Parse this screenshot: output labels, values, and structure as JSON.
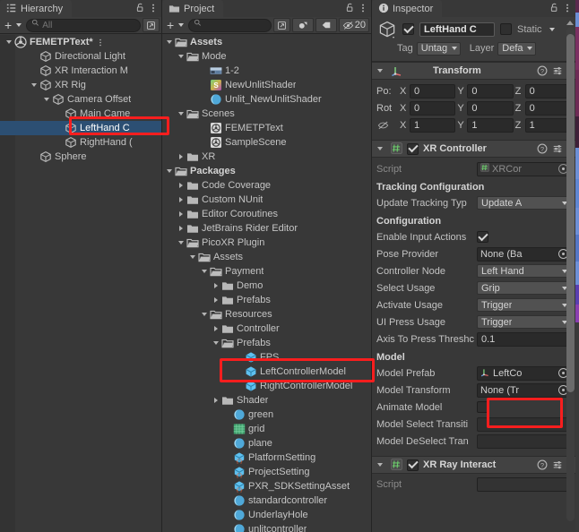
{
  "hierarchy": {
    "tab_label": "Hierarchy",
    "lock_icon": "lock-icon",
    "menu_icon": "kebab-menu-icon",
    "create_label": "+",
    "search_placeholder": "All",
    "search_value": "",
    "rows": [
      {
        "label": "FEMETPText*",
        "depth": 0,
        "arrow": "down",
        "icon": "scene-icon",
        "bold": true,
        "selected": false,
        "kebab": true
      },
      {
        "label": "Directional Light",
        "depth": 2,
        "arrow": "none",
        "icon": "gameobject-icon",
        "bold": false,
        "selected": false
      },
      {
        "label": "XR Interaction M",
        "depth": 2,
        "arrow": "none",
        "icon": "gameobject-icon",
        "bold": false,
        "selected": false
      },
      {
        "label": "XR Rig",
        "depth": 2,
        "arrow": "down",
        "icon": "gameobject-icon",
        "bold": false,
        "selected": false
      },
      {
        "label": "Camera Offset",
        "depth": 3,
        "arrow": "down",
        "icon": "gameobject-icon",
        "bold": false,
        "selected": false
      },
      {
        "label": "Main Came",
        "depth": 4,
        "arrow": "none",
        "icon": "gameobject-icon",
        "bold": false,
        "selected": false
      },
      {
        "label": "LeftHand C",
        "depth": 4,
        "arrow": "none",
        "icon": "gameobject-icon",
        "bold": false,
        "selected": true
      },
      {
        "label": "RightHand (",
        "depth": 4,
        "arrow": "none",
        "icon": "gameobject-icon",
        "bold": false,
        "selected": false
      },
      {
        "label": "Sphere",
        "depth": 2,
        "arrow": "none",
        "icon": "gameobject-icon",
        "bold": false,
        "selected": false
      }
    ]
  },
  "project": {
    "tab_label": "Project",
    "lock_icon": "lock-icon",
    "menu_icon": "kebab-menu-icon",
    "create_label": "+",
    "search_placeholder": "",
    "search_value": "",
    "filter_icons": [
      "asset-type-filter-icon",
      "label-filter-icon"
    ],
    "hidden_count_label": "20",
    "rows": [
      {
        "label": "Assets",
        "depth": 0,
        "arrow": "down",
        "icon": "folder-open-icon",
        "bold": true
      },
      {
        "label": "Mode",
        "depth": 1,
        "arrow": "down",
        "icon": "folder-open-icon",
        "bold": false
      },
      {
        "label": "1-2",
        "depth": 3,
        "arrow": "none",
        "icon": "image-icon",
        "bold": false
      },
      {
        "label": "NewUnlitShader",
        "depth": 3,
        "arrow": "none",
        "icon": "shader-icon",
        "bold": false
      },
      {
        "label": "Unlit_NewUnlitShader",
        "depth": 3,
        "arrow": "none",
        "icon": "material-icon",
        "bold": false
      },
      {
        "label": "Scenes",
        "depth": 1,
        "arrow": "down",
        "icon": "folder-open-icon",
        "bold": false
      },
      {
        "label": "FEMETPText",
        "depth": 3,
        "arrow": "none",
        "icon": "scene-asset-icon",
        "bold": false
      },
      {
        "label": "SampleScene",
        "depth": 3,
        "arrow": "none",
        "icon": "scene-asset-icon",
        "bold": false
      },
      {
        "label": "XR",
        "depth": 1,
        "arrow": "right",
        "icon": "folder-icon",
        "bold": false
      },
      {
        "label": "Packages",
        "depth": 0,
        "arrow": "down",
        "icon": "folder-open-icon",
        "bold": true
      },
      {
        "label": "Code Coverage",
        "depth": 1,
        "arrow": "right",
        "icon": "folder-icon",
        "bold": false
      },
      {
        "label": "Custom NUnit",
        "depth": 1,
        "arrow": "right",
        "icon": "folder-icon",
        "bold": false
      },
      {
        "label": "Editor Coroutines",
        "depth": 1,
        "arrow": "right",
        "icon": "folder-icon",
        "bold": false
      },
      {
        "label": "JetBrains Rider Editor",
        "depth": 1,
        "arrow": "right",
        "icon": "folder-icon",
        "bold": false
      },
      {
        "label": "PicoXR Plugin",
        "depth": 1,
        "arrow": "down",
        "icon": "folder-open-icon",
        "bold": false
      },
      {
        "label": "Assets",
        "depth": 2,
        "arrow": "down",
        "icon": "folder-open-icon",
        "bold": false
      },
      {
        "label": "Payment",
        "depth": 3,
        "arrow": "down",
        "icon": "folder-open-icon",
        "bold": false
      },
      {
        "label": "Demo",
        "depth": 4,
        "arrow": "right",
        "icon": "folder-icon",
        "bold": false
      },
      {
        "label": "Prefabs",
        "depth": 4,
        "arrow": "right",
        "icon": "folder-icon",
        "bold": false
      },
      {
        "label": "Resources",
        "depth": 3,
        "arrow": "down",
        "icon": "folder-open-icon",
        "bold": false
      },
      {
        "label": "Controller",
        "depth": 4,
        "arrow": "right",
        "icon": "folder-icon",
        "bold": false
      },
      {
        "label": "Prefabs",
        "depth": 4,
        "arrow": "down",
        "icon": "folder-open-icon",
        "bold": false
      },
      {
        "label": "FPS",
        "depth": 6,
        "arrow": "none",
        "icon": "prefab-icon",
        "bold": false
      },
      {
        "label": "LeftControllerModel",
        "depth": 6,
        "arrow": "none",
        "icon": "prefab-icon",
        "bold": false
      },
      {
        "label": "RightControllerModel",
        "depth": 6,
        "arrow": "none",
        "icon": "prefab-icon",
        "bold": false
      },
      {
        "label": "Shader",
        "depth": 4,
        "arrow": "right",
        "icon": "folder-icon",
        "bold": false
      },
      {
        "label": "green",
        "depth": 5,
        "arrow": "none",
        "icon": "material-icon",
        "bold": false
      },
      {
        "label": "grid",
        "depth": 5,
        "arrow": "none",
        "icon": "texture-icon",
        "bold": false
      },
      {
        "label": "plane",
        "depth": 5,
        "arrow": "none",
        "icon": "material-icon",
        "bold": false
      },
      {
        "label": "PlatformSetting",
        "depth": 5,
        "arrow": "none",
        "icon": "scriptable-object-icon",
        "bold": false
      },
      {
        "label": "ProjectSetting",
        "depth": 5,
        "arrow": "none",
        "icon": "scriptable-object-icon",
        "bold": false
      },
      {
        "label": "PXR_SDKSettingAsset",
        "depth": 5,
        "arrow": "none",
        "icon": "scriptable-object-icon",
        "bold": false
      },
      {
        "label": "standardcontroller",
        "depth": 5,
        "arrow": "none",
        "icon": "material-icon",
        "bold": false
      },
      {
        "label": "UnderlayHole",
        "depth": 5,
        "arrow": "none",
        "icon": "material-icon",
        "bold": false
      },
      {
        "label": "unlitcontroller",
        "depth": 5,
        "arrow": "none",
        "icon": "material-icon",
        "bold": false
      }
    ]
  },
  "inspector": {
    "tab_label": "Inspector",
    "tab_icon": "info-icon",
    "lock_icon": "lock-icon",
    "menu_icon": "kebab-menu-icon",
    "object_icon": "gameobject-icon",
    "enabled": true,
    "name_value": "LeftHand C",
    "static_label": "Static",
    "static_checked": false,
    "tag_label": "Tag",
    "tag_value": "Untag",
    "layer_label": "Layer",
    "layer_value": "Defa",
    "transform": {
      "title": "Transform",
      "icon": "transform-icon",
      "help_icon": "help-icon",
      "preset_icon": "preset-icon",
      "menu_icon": "kebab-menu-icon",
      "position_label": "Po:",
      "rotation_label": "Rot",
      "scale_label": "scale-lock-icon",
      "axes": [
        "X",
        "Y",
        "Z"
      ],
      "position": [
        "0",
        "0",
        "0"
      ],
      "rotation": [
        "0",
        "0",
        "0"
      ],
      "scale": [
        "1",
        "1",
        "1"
      ]
    },
    "xr_controller": {
      "title": "XR Controller",
      "icon": "script-icon",
      "enabled": true,
      "help_icon": "help-icon",
      "preset_icon": "preset-icon",
      "menu_icon": "kebab-menu-icon",
      "script_label": "Script",
      "script_value": "XRCor",
      "tracking_section": "Tracking Configuration",
      "update_tracking_label": "Update Tracking Typ",
      "update_tracking_value": "Update A",
      "configuration_section": "Configuration",
      "enable_input_actions_label": "Enable Input Actions",
      "enable_input_actions_checked": true,
      "pose_provider_label": "Pose Provider",
      "pose_provider_value": "None (Ba",
      "controller_node_label": "Controller Node",
      "controller_node_value": "Left Hand",
      "select_usage_label": "Select Usage",
      "select_usage_value": "Grip",
      "activate_usage_label": "Activate Usage",
      "activate_usage_value": "Trigger",
      "ui_press_usage_label": "UI Press Usage",
      "ui_press_usage_value": "Trigger",
      "axis_threshold_label": "Axis To Press Threshc",
      "axis_threshold_value": "0.1",
      "model_section": "Model",
      "model_prefab_label": "Model Prefab",
      "model_prefab_value": "LeftCo",
      "model_prefab_icon": "transform-icon",
      "model_transform_label": "Model Transform",
      "model_transform_value": "None (Tr",
      "animate_model_label": "Animate Model",
      "animate_model_checked": false,
      "model_select_label": "Model Select Transiti",
      "model_select_value": "",
      "model_deselect_label": "Model DeSelect Tran",
      "model_deselect_value": ""
    },
    "xr_ray_interactor": {
      "title": "XR Ray Interact",
      "icon": "script-icon",
      "enabled": true,
      "help_icon": "help-icon",
      "preset_icon": "preset-icon",
      "menu_icon": "kebab-menu-icon"
    }
  },
  "annotations": [
    {
      "name": "hierarchy-lefthand-highlight",
      "color": "#f81e1e"
    },
    {
      "name": "project-leftcontrollermodel-highlight",
      "color": "#f81e1e"
    },
    {
      "name": "inspector-model-prefab-highlight",
      "color": "#f81e1e"
    }
  ],
  "colors": {
    "panel_bg": "#383838",
    "header_bg": "#3c3c3c",
    "selection_blue": "#2c4f73",
    "annotation_red": "#f81e1e",
    "prefab_blue": "#54b9e8",
    "text": "#c4c4c4"
  }
}
